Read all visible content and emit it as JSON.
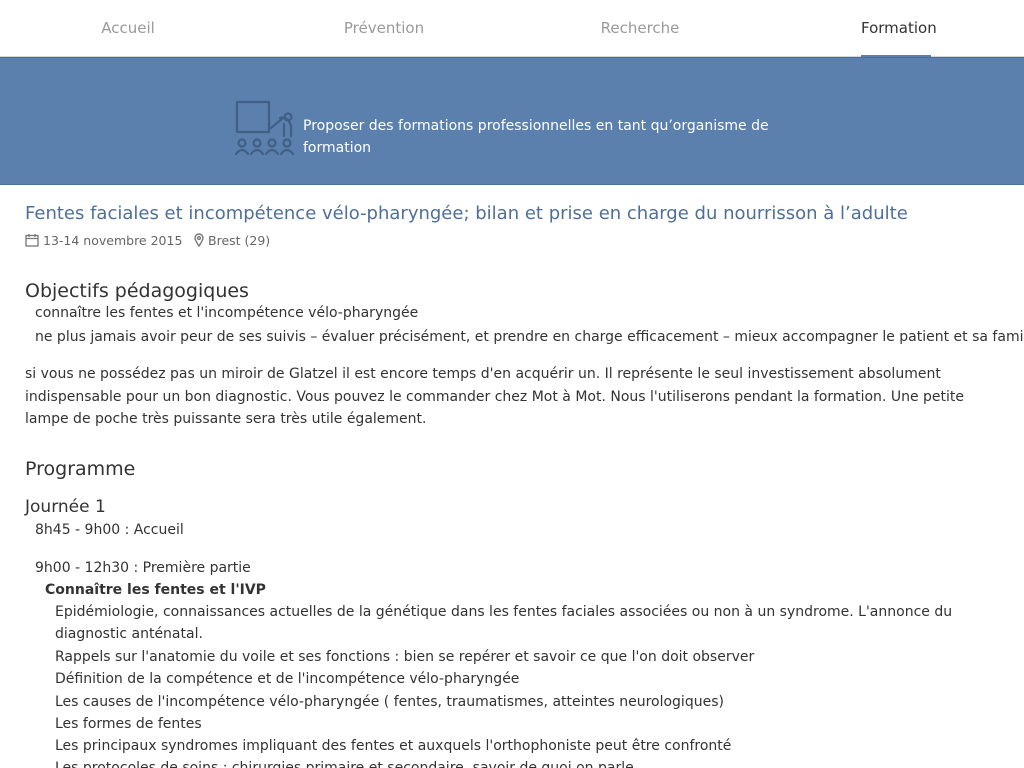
{
  "nav": {
    "tabs": [
      {
        "label": "Accueil",
        "active": false
      },
      {
        "label": "Prévention",
        "active": false
      },
      {
        "label": "Recherche",
        "active": false
      },
      {
        "label": "Formation",
        "active": true
      }
    ]
  },
  "banner": {
    "icon": "training-classroom-icon",
    "text": "Proposer des formations professionnelles en tant qu’organisme de formation",
    "color": "#5b80ad"
  },
  "course": {
    "title": "Fentes faciales et incompétence vélo-pharyngée; bilan et prise en charge du nourrisson à l’adulte",
    "date": "13-14 novembre 2015",
    "location": "Brest (29)"
  },
  "objectives": {
    "heading": "Objectifs pédagogiques",
    "items": [
      "connaître les fentes et l'incompétence vélo-pharyngée",
      "ne plus jamais avoir peur de ses suivis – évaluer précisément, et prendre en charge efficacement – mieux accompagner le patient et sa famille"
    ],
    "note": "si vous ne possédez pas un miroir de Glatzel il est encore temps d'en acquérir un. Il représente le seul investissement absolument indispensable pour un bon diagnostic. Vous pouvez le commander chez Mot à Mot. Nous l'utiliserons pendant la formation. Une petite lampe de poche très puissante sera très utile également."
  },
  "programme": {
    "heading": "Programme",
    "day1": {
      "heading": "Journée 1",
      "welcome": "8h45 - 9h00 : Accueil",
      "part1": "9h00 - 12h30 : Première partie",
      "section": "Connaître les fentes et l'IVP",
      "items": [
        "Epidémiologie, connaissances actuelles de la génétique dans les fentes faciales associées ou non à un syndrome. L'annonce du diagnostic anténatal.",
        "Rappels sur l'anatomie du voile et ses fonctions : bien se repérer et savoir ce que l'on doit observer",
        "Définition de la compétence et de l'incompétence vélo-pharyngée",
        "Les causes de l'incompétence vélo-pharyngée ( fentes, traumatismes, atteintes neurologiques)",
        "Les formes de fentes",
        "Les principaux syndromes impliquant des fentes et auxquels l'orthophoniste peut être confronté",
        "Les protocoles de soins : chirurgies primaire et secondaire, savoir de quoi on parle"
      ]
    }
  }
}
